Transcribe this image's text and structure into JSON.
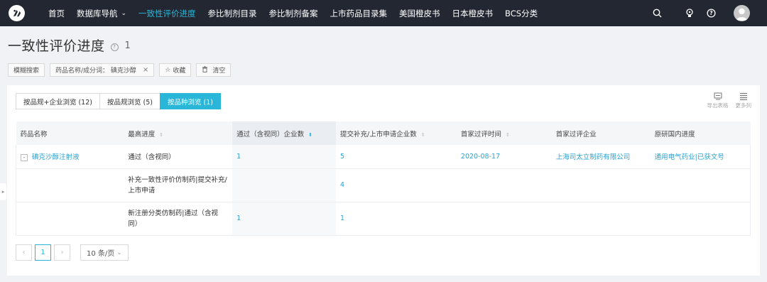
{
  "nav": {
    "items": [
      {
        "label": "首页",
        "active": false
      },
      {
        "label": "数据库导航",
        "active": false,
        "dropdown": true
      },
      {
        "label": "一致性评价进度",
        "active": true
      },
      {
        "label": "参比制剂目录",
        "active": false
      },
      {
        "label": "参比制剂备案",
        "active": false
      },
      {
        "label": "上市药品目录集",
        "active": false
      },
      {
        "label": "美国橙皮书",
        "active": false
      },
      {
        "label": "日本橙皮书",
        "active": false
      },
      {
        "label": "BCS分类",
        "active": false
      }
    ],
    "caret": "⌄"
  },
  "page": {
    "title": "一致性评价进度",
    "help": "?",
    "count": "1"
  },
  "filters": {
    "fuzzy_search": "模糊搜索",
    "keyword_chip": "药品名称/成分词：  碘克沙醇",
    "remove": "×",
    "favorite": "收藏",
    "favorite_star": "☆",
    "clear": "清空"
  },
  "tabs": [
    {
      "label": "按品规+企业浏览 (12)",
      "active": false
    },
    {
      "label": "按品规浏览 (5)",
      "active": false
    },
    {
      "label": "按品种浏览 (1)",
      "active": true
    }
  ],
  "tools": {
    "export": "导出表格",
    "more_columns": "更多列"
  },
  "table": {
    "headers": [
      {
        "label": "药品名称",
        "sortable": false
      },
      {
        "label": "最高进度",
        "sortable": true
      },
      {
        "label": "通过（含视同）企业数",
        "sortable": true,
        "sorted": true
      },
      {
        "label": "提交补充/上市申请企业数",
        "sortable": true
      },
      {
        "label": "首家过评时间",
        "sortable": true
      },
      {
        "label": "首家过评企业",
        "sortable": false
      },
      {
        "label": "原研国内进度",
        "sortable": false
      }
    ],
    "sort_icon": "⇕",
    "sort_icon_active": "⬍",
    "expand_icon": "-",
    "rows": [
      {
        "name": "碘克沙醇注射液",
        "progress": "通过（含视同）",
        "passed": "1",
        "submitted": "5",
        "first_date": "2020-08-17",
        "first_company": "上海司太立制药有限公司",
        "original": "通用电气药业|已获文号"
      },
      {
        "name": "",
        "progress": "补充一致性评价仿制药|提交补充/上市申请",
        "passed": "",
        "submitted": "4",
        "first_date": "",
        "first_company": "",
        "original": ""
      },
      {
        "name": "",
        "progress": "新注册分类仿制药|通过（含视同）",
        "passed": "1",
        "submitted": "1",
        "first_date": "",
        "first_company": "",
        "original": ""
      }
    ]
  },
  "pager": {
    "prev": "‹",
    "current": "1",
    "next": "›",
    "page_size": "10 条/页",
    "caret": "⌄"
  },
  "side_handle": "▸",
  "colors": {
    "accent": "#29b6d9",
    "link": "#29a3d0",
    "topbar": "#232732"
  }
}
